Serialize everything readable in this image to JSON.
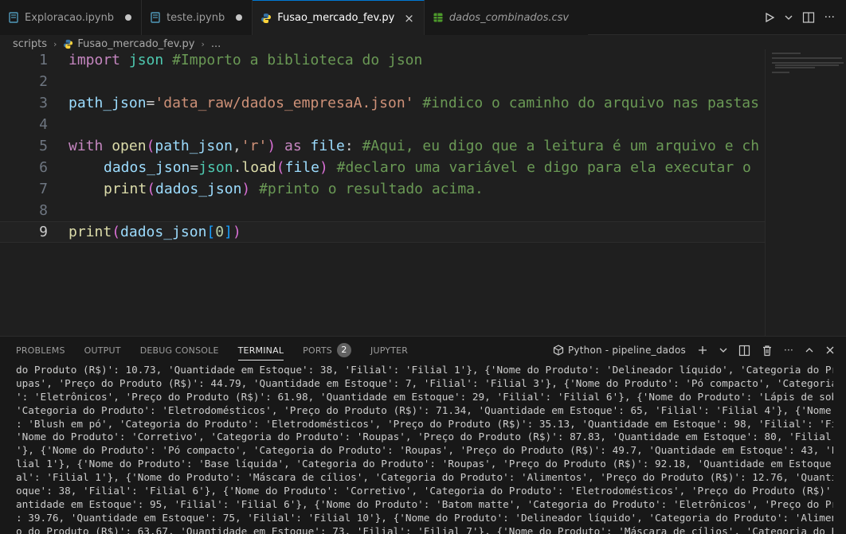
{
  "tabs": [
    {
      "label": "Exploracao.ipynb",
      "icon": "notebook-icon",
      "modified": true
    },
    {
      "label": "teste.ipynb",
      "icon": "notebook-icon",
      "modified": true
    },
    {
      "label": "Fusao_mercado_fev.py",
      "icon": "python-file-icon",
      "active": true,
      "close": "×"
    },
    {
      "label": "dados_combinados.csv",
      "icon": "csv-file-icon"
    }
  ],
  "breadcrumb": {
    "folder": "scripts",
    "file": "Fusao_mercado_fev.py",
    "more": "..."
  },
  "code": {
    "line_numbers": [
      "1",
      "2",
      "3",
      "4",
      "5",
      "6",
      "7",
      "8",
      "9"
    ],
    "current_line": "9",
    "l1": {
      "kw": "import",
      "mod": "json",
      "comment": "#Importo a biblioteca do json"
    },
    "l3": {
      "var": "path_json",
      "eq": "=",
      "str": "'data_raw/dados_empresaA.json'",
      "comment": "#indico o caminho do arquivo nas pastas"
    },
    "l5": {
      "kw": "with",
      "fn": "open",
      "p1": "(",
      "arg": "path_json",
      "comma": ",",
      "str": "'r'",
      "p2": ")",
      "as": "as",
      "file": "file",
      "colon": ":",
      "comment": "#Aqui, eu digo que a leitura é um arquivo e ch"
    },
    "l6": {
      "var": "dados_json",
      "eq": "=",
      "mod": "json",
      "dot": ".",
      "fn": "load",
      "p1": "(",
      "arg": "file",
      "p2": ")",
      "comment": "#declaro uma variável e digo para ela executar o"
    },
    "l7": {
      "fn": "print",
      "p1": "(",
      "arg": "dados_json",
      "p2": ")",
      "comment": "#printo o resultado acima."
    },
    "l9": {
      "fn": "print",
      "p1": "(",
      "arg": "dados_json",
      "b1": "[",
      "num": "0",
      "b2": "]",
      "p2": ")"
    }
  },
  "panel": {
    "tabs": [
      "PROBLEMS",
      "OUTPUT",
      "DEBUG CONSOLE",
      "TERMINAL",
      "PORTS",
      "JUPYTER"
    ],
    "active_tab": "TERMINAL",
    "ports_count": "2",
    "terminal_name": "Python - pipeline_dados"
  },
  "terminal_lines": [
    "do Produto (R$)': 10.73, 'Quantidade em Estoque': 38, 'Filial': 'Filial 1'}, {'Nome do Produto': 'Delineador líquido', 'Categoria do Produto': 'Ro",
    "upas', 'Preço do Produto (R$)': 44.79, 'Quantidade em Estoque': 7, 'Filial': 'Filial 3'}, {'Nome do Produto': 'Pó compacto', 'Categoria do Produto",
    "': 'Eletrônicos', 'Preço do Produto (R$)': 61.98, 'Quantidade em Estoque': 29, 'Filial': 'Filial 6'}, {'Nome do Produto': 'Lápis de sobrancelha',",
    "'Categoria do Produto': 'Eletrodomésticos', 'Preço do Produto (R$)': 71.34, 'Quantidade em Estoque': 65, 'Filial': 'Filial 4'}, {'Nome do Produto'",
    ": 'Blush em pó', 'Categoria do Produto': 'Eletrodomésticos', 'Preço do Produto (R$)': 35.13, 'Quantidade em Estoque': 98, 'Filial': 'Filial 8'}, {",
    "'Nome do Produto': 'Corretivo', 'Categoria do Produto': 'Roupas', 'Preço do Produto (R$)': 87.83, 'Quantidade em Estoque': 80, 'Filial': 'Filial 3",
    "'}, {'Nome do Produto': 'Pó compacto', 'Categoria do Produto': 'Roupas', 'Preço do Produto (R$)': 49.7, 'Quantidade em Estoque': 43, 'Filial': 'Fi",
    "lial 1'}, {'Nome do Produto': 'Base líquida', 'Categoria do Produto': 'Roupas', 'Preço do Produto (R$)': 92.18, 'Quantidade em Estoque': 79, 'Fili",
    "al': 'Filial 1'}, {'Nome do Produto': 'Máscara de cílios', 'Categoria do Produto': 'Alimentos', 'Preço do Produto (R$)': 12.76, 'Quantidade em Est",
    "oque': 38, 'Filial': 'Filial 6'}, {'Nome do Produto': 'Corretivo', 'Categoria do Produto': 'Eletrodomésticos', 'Preço do Produto (R$)': 71.01, 'Qu",
    "antidade em Estoque': 95, 'Filial': 'Filial 6'}, {'Nome do Produto': 'Batom matte', 'Categoria do Produto': 'Eletrônicos', 'Preço do Produto (R$)'",
    ": 39.76, 'Quantidade em Estoque': 75, 'Filial': 'Filial 10'}, {'Nome do Produto': 'Delineador líquido', 'Categoria do Produto': 'Alimentos', 'Preç",
    "o do Produto (R$)': 63.67, 'Quantidade em Estoque': 73, 'Filial': 'Filial 7'}, {'Nome do Produto': 'Máscara de cílios', 'Categoria do Produto': 'R"
  ],
  "colors": {
    "accent": "#0078d4",
    "keyword": "#c586c0",
    "string": "#ce9178",
    "comment": "#6a9955"
  }
}
